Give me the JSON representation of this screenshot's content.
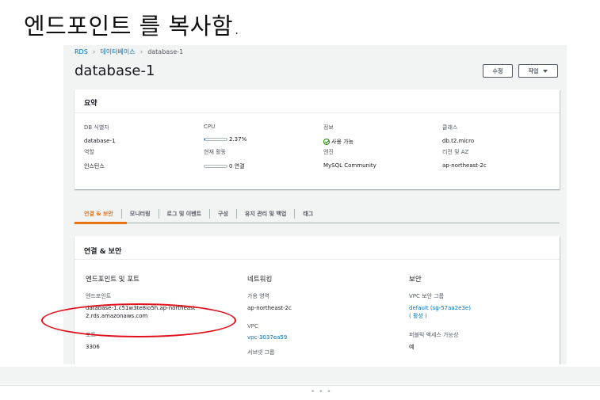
{
  "caption": "엔드포인트 를 복사함.",
  "breadcrumb": [
    "RDS",
    "데이터베이스",
    "database-1"
  ],
  "page_title": "database-1",
  "buttons": {
    "edit": "수정",
    "actions": "작업"
  },
  "summary": {
    "title": "요약",
    "fields": [
      {
        "label": "DB 식별자",
        "value": "database-1"
      },
      {
        "label": "CPU",
        "value": "2.37%",
        "progress_percent": 2.37
      },
      {
        "label": "정보",
        "value": "사용 가능"
      },
      {
        "label": "클래스",
        "value": "db.t2.micro"
      },
      {
        "label": "역할",
        "value": "인스턴스"
      },
      {
        "label": "현재 활동",
        "value": "0 연결",
        "progress_percent": 0
      },
      {
        "label": "엔진",
        "value": "MySQL Community"
      },
      {
        "label": "리전 및 AZ",
        "value": "ap-northeast-2c"
      }
    ]
  },
  "tabs": [
    "연결 & 보안",
    "모니터링",
    "로그 및 이벤트",
    "구성",
    "유지 관리 및 백업",
    "태그"
  ],
  "active_tab": "연결 & 보안",
  "connectivity": {
    "title": "연결 & 보안",
    "endpoint_col": {
      "heading": "엔드포인트 및 포트",
      "endpoint_label": "엔드포인트",
      "endpoint_value": "database-1.c51w3te8io5h.ap-northeast-2.rds.amazonaws.com",
      "port_label": "포트",
      "port_value": "3306"
    },
    "network_col": {
      "heading": "네트워킹",
      "az_label": "가용 영역",
      "az_value": "ap-northeast-2c",
      "vpc_label": "VPC",
      "vpc_value": "vpc-3037ea59",
      "subnet_label_partial": "서브넷 그룹"
    },
    "security_col": {
      "heading": "보안",
      "sg_label": "VPC 보안 그룹",
      "sg_value": "default (sg-57aa2e3e)",
      "sg_status": "( 활성 )",
      "public_label": "퍼블릭 액세스 가능성",
      "public_value": "예"
    }
  },
  "colors": {
    "accent": "#ec7211",
    "link": "#0073bb",
    "ok": "#1d8102",
    "highlight": "#e0101b"
  }
}
